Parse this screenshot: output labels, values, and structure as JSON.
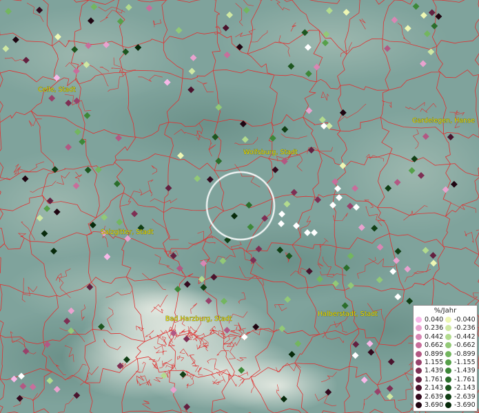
{
  "map": {
    "cities": [
      {
        "name": "Celle, Stadt"
      },
      {
        "name": "Wolfsburg, Stadt"
      },
      {
        "name": "Gardelegen, Hanse"
      },
      {
        "name": "Salzgitter, Stadt"
      },
      {
        "name": "Bad Harzburg, Stadt"
      },
      {
        "name": "Halberstadt, Stadt"
      }
    ],
    "highlight": "selection-circle"
  },
  "legend": {
    "title": "%/Jahr",
    "positive": [
      {
        "value": "0.040",
        "color": "#f7b8e8"
      },
      {
        "value": "0.236",
        "color": "#e9a2cf"
      },
      {
        "value": "0.442",
        "color": "#d986b4"
      },
      {
        "value": "0.662",
        "color": "#c86e9b"
      },
      {
        "value": "0.899",
        "color": "#b25883"
      },
      {
        "value": "1.155",
        "color": "#98426b"
      },
      {
        "value": "1.439",
        "color": "#7e2f54"
      },
      {
        "value": "1.761",
        "color": "#632040"
      },
      {
        "value": "2.143",
        "color": "#4a132d"
      },
      {
        "value": "2.639",
        "color": "#340a1e"
      },
      {
        "value": "3.690",
        "color": "#1f0511"
      }
    ],
    "negative": [
      {
        "value": "-0.040",
        "color": "#eef7b4"
      },
      {
        "value": "-0.236",
        "color": "#cfe8a3"
      },
      {
        "value": "-0.442",
        "color": "#b2db8e"
      },
      {
        "value": "-0.662",
        "color": "#92c977"
      },
      {
        "value": "-0.899",
        "color": "#73b65f"
      },
      {
        "value": "-1.155",
        "color": "#56a049"
      },
      {
        "value": "-1.439",
        "color": "#3d8838"
      },
      {
        "value": "-1.761",
        "color": "#2b6e2b"
      },
      {
        "value": "-2.143",
        "color": "#1d561f"
      },
      {
        "value": "-2.639",
        "color": "#113f15"
      },
      {
        "value": "-3.690",
        "color": "#072a0b"
      }
    ]
  },
  "colors": {
    "background": "#7fa39c",
    "boundaries": "#e03030",
    "city_label": "#f0e000",
    "no_data": "#ffffff"
  }
}
